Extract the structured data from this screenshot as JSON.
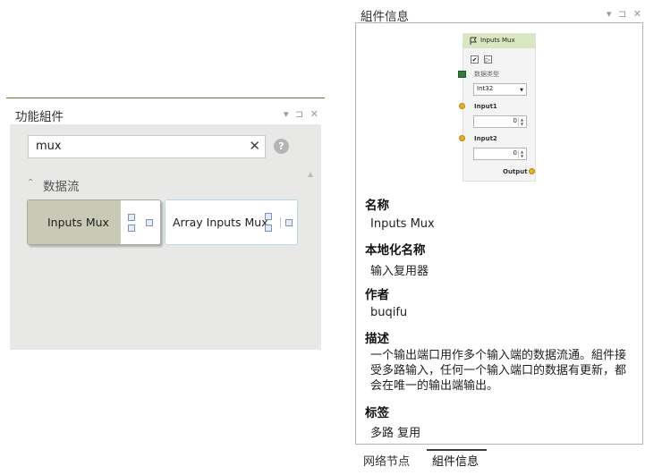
{
  "left_panel": {
    "title": "功能組件",
    "header_icons": "▾ ⊐ ✕",
    "search": {
      "value": "mux",
      "clear_icon": "✕",
      "help_icon": "?"
    },
    "group": {
      "label": "数据流",
      "chevron": "⌃"
    },
    "cards": [
      {
        "label": "Inputs Mux"
      },
      {
        "label": "Array Inputs Mux"
      }
    ]
  },
  "right_panel": {
    "title": "組件信息",
    "header_icons": "▾ ⊐ ✕",
    "node": {
      "title": "Inputs Mux",
      "checkbox_mark": "✔",
      "play_mark": "▷",
      "datatype_label": "数据类型",
      "datatype_value": "Int32",
      "input1_label": "Input1",
      "input1_value": "0",
      "input2_label": "Input2",
      "input2_value": "0",
      "output_label": "Output"
    },
    "fields": {
      "name_label": "名称",
      "name_value": "Inputs Mux",
      "localized_label": "本地化名称",
      "localized_value": "输入复用器",
      "author_label": "作者",
      "author_value": "buqifu",
      "desc_label": "描述",
      "desc_value": "一个输出端口用作多个输入端的数据流通。組件接受多路输入，任何一个输入端口的数据有更新，都会在唯一的输出端输出。",
      "tags_label": "标签",
      "tags_value": "多路 复用"
    },
    "tabs": [
      {
        "label": "网络节点"
      },
      {
        "label": "組件信息"
      }
    ]
  }
}
